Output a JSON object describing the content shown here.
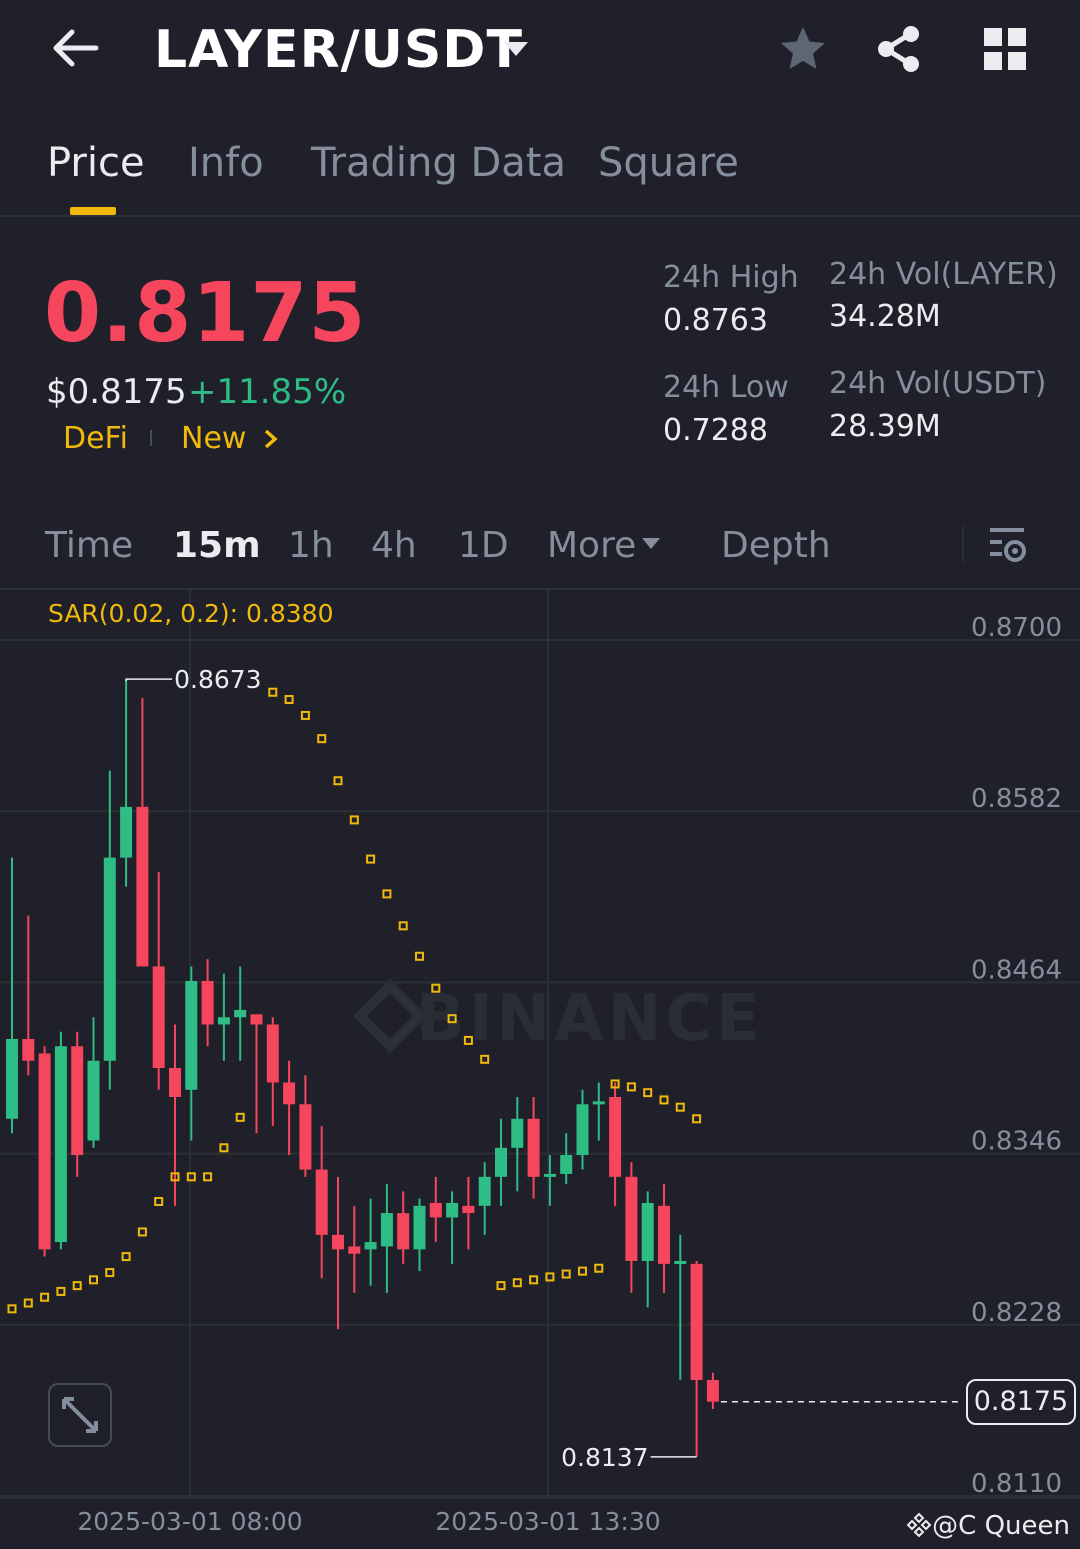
{
  "header": {
    "pair": "LAYER/USDT"
  },
  "tabs": [
    "Price",
    "Info",
    "Trading Data",
    "Square"
  ],
  "ticker": {
    "last_price": "0.8175",
    "usd_price": "$0.8175",
    "change_pct": "+11.85%",
    "tags": [
      "DeFi",
      "New"
    ],
    "high_label": "24h High",
    "high_value": "0.8763",
    "low_label": "24h Low",
    "low_value": "0.7288",
    "vol_base_label": "24h Vol(LAYER)",
    "vol_base_value": "34.28M",
    "vol_quote_label": "24h Vol(USDT)",
    "vol_quote_value": "28.39M"
  },
  "intervals": {
    "items": [
      "Time",
      "15m",
      "1h",
      "4h",
      "1D"
    ],
    "more": "More",
    "depth": "Depth",
    "active": "15m"
  },
  "indicator": {
    "label": "SAR(0.02, 0.2): 0.8380"
  },
  "watermark": "BINANCE",
  "credit": "@C Queen",
  "colors": {
    "up": "#2ebd85",
    "down": "#f6465d",
    "accent": "#f0b90b",
    "background": "#1f2029"
  },
  "chart_data": {
    "type": "candlestick",
    "interval": "15m",
    "y_ticks": [
      "0.8700",
      "0.8582",
      "0.8464",
      "0.8346",
      "0.8228",
      "0.8110"
    ],
    "x_ticks": [
      "2025-03-01 08:00",
      "2025-03-01 13:30"
    ],
    "high_marker": "0.8673",
    "low_marker": "0.8137",
    "current_price": "0.8175",
    "candles": [
      {
        "o": 0.837,
        "h": 0.855,
        "l": 0.836,
        "c": 0.8425
      },
      {
        "o": 0.8425,
        "h": 0.851,
        "l": 0.84,
        "c": 0.841
      },
      {
        "o": 0.8415,
        "h": 0.842,
        "l": 0.8275,
        "c": 0.828
      },
      {
        "o": 0.8285,
        "h": 0.843,
        "l": 0.828,
        "c": 0.842
      },
      {
        "o": 0.842,
        "h": 0.843,
        "l": 0.833,
        "c": 0.8345
      },
      {
        "o": 0.8355,
        "h": 0.844,
        "l": 0.835,
        "c": 0.841
      },
      {
        "o": 0.841,
        "h": 0.861,
        "l": 0.839,
        "c": 0.855
      },
      {
        "o": 0.855,
        "h": 0.8673,
        "l": 0.853,
        "c": 0.8585
      },
      {
        "o": 0.8585,
        "h": 0.866,
        "l": 0.848,
        "c": 0.8475
      },
      {
        "o": 0.8475,
        "h": 0.854,
        "l": 0.839,
        "c": 0.8405
      },
      {
        "o": 0.8405,
        "h": 0.8435,
        "l": 0.831,
        "c": 0.8385
      },
      {
        "o": 0.839,
        "h": 0.8475,
        "l": 0.8355,
        "c": 0.8465
      },
      {
        "o": 0.8465,
        "h": 0.848,
        "l": 0.842,
        "c": 0.8435
      },
      {
        "o": 0.8435,
        "h": 0.847,
        "l": 0.841,
        "c": 0.844
      },
      {
        "o": 0.844,
        "h": 0.8475,
        "l": 0.841,
        "c": 0.8445
      },
      {
        "o": 0.8442,
        "h": 0.844,
        "l": 0.836,
        "c": 0.8435
      },
      {
        "o": 0.8435,
        "h": 0.844,
        "l": 0.8365,
        "c": 0.8395
      },
      {
        "o": 0.8395,
        "h": 0.841,
        "l": 0.8345,
        "c": 0.838
      },
      {
        "o": 0.838,
        "h": 0.84,
        "l": 0.833,
        "c": 0.8335
      },
      {
        "o": 0.8335,
        "h": 0.8365,
        "l": 0.826,
        "c": 0.829
      },
      {
        "o": 0.829,
        "h": 0.833,
        "l": 0.8225,
        "c": 0.828
      },
      {
        "o": 0.8282,
        "h": 0.831,
        "l": 0.825,
        "c": 0.8277
      },
      {
        "o": 0.828,
        "h": 0.8315,
        "l": 0.8255,
        "c": 0.8285
      },
      {
        "o": 0.8282,
        "h": 0.8325,
        "l": 0.825,
        "c": 0.8305
      },
      {
        "o": 0.8305,
        "h": 0.832,
        "l": 0.827,
        "c": 0.828
      },
      {
        "o": 0.828,
        "h": 0.8315,
        "l": 0.8265,
        "c": 0.831
      },
      {
        "o": 0.8312,
        "h": 0.833,
        "l": 0.8285,
        "c": 0.8302
      },
      {
        "o": 0.8302,
        "h": 0.832,
        "l": 0.827,
        "c": 0.8312
      },
      {
        "o": 0.831,
        "h": 0.833,
        "l": 0.828,
        "c": 0.8305
      },
      {
        "o": 0.831,
        "h": 0.834,
        "l": 0.829,
        "c": 0.833
      },
      {
        "o": 0.833,
        "h": 0.837,
        "l": 0.831,
        "c": 0.835
      },
      {
        "o": 0.835,
        "h": 0.8385,
        "l": 0.832,
        "c": 0.837
      },
      {
        "o": 0.837,
        "h": 0.8385,
        "l": 0.8315,
        "c": 0.833
      },
      {
        "o": 0.833,
        "h": 0.8345,
        "l": 0.831,
        "c": 0.8332
      },
      {
        "o": 0.8332,
        "h": 0.836,
        "l": 0.8325,
        "c": 0.8345
      },
      {
        "o": 0.8345,
        "h": 0.839,
        "l": 0.8335,
        "c": 0.838
      },
      {
        "o": 0.838,
        "h": 0.8395,
        "l": 0.8355,
        "c": 0.8382
      },
      {
        "o": 0.8385,
        "h": 0.8395,
        "l": 0.831,
        "c": 0.833
      },
      {
        "o": 0.833,
        "h": 0.834,
        "l": 0.825,
        "c": 0.8272
      },
      {
        "o": 0.8272,
        "h": 0.832,
        "l": 0.824,
        "c": 0.8312
      },
      {
        "o": 0.831,
        "h": 0.8325,
        "l": 0.825,
        "c": 0.827
      },
      {
        "o": 0.827,
        "h": 0.829,
        "l": 0.819,
        "c": 0.8272
      },
      {
        "o": 0.827,
        "h": 0.8272,
        "l": 0.8137,
        "c": 0.819
      },
      {
        "o": 0.819,
        "h": 0.8195,
        "l": 0.817,
        "c": 0.8175
      }
    ],
    "sar": [
      {
        "i": 0,
        "v": 0.8239
      },
      {
        "i": 1,
        "v": 0.8243
      },
      {
        "i": 2,
        "v": 0.8247
      },
      {
        "i": 3,
        "v": 0.8251
      },
      {
        "i": 4,
        "v": 0.8255
      },
      {
        "i": 5,
        "v": 0.8259
      },
      {
        "i": 6,
        "v": 0.8264
      },
      {
        "i": 7,
        "v": 0.8275
      },
      {
        "i": 8,
        "v": 0.8292
      },
      {
        "i": 9,
        "v": 0.8313
      },
      {
        "i": 10,
        "v": 0.833
      },
      {
        "i": 11,
        "v": 0.833
      },
      {
        "i": 12,
        "v": 0.833
      },
      {
        "i": 13,
        "v": 0.835
      },
      {
        "i": 14,
        "v": 0.8371
      },
      {
        "i": 16,
        "v": 0.8664
      },
      {
        "i": 17,
        "v": 0.8659
      },
      {
        "i": 18,
        "v": 0.8648
      },
      {
        "i": 19,
        "v": 0.8632
      },
      {
        "i": 20,
        "v": 0.8603
      },
      {
        "i": 21,
        "v": 0.8576
      },
      {
        "i": 22,
        "v": 0.8549
      },
      {
        "i": 23,
        "v": 0.8525
      },
      {
        "i": 24,
        "v": 0.8503
      },
      {
        "i": 25,
        "v": 0.8482
      },
      {
        "i": 26,
        "v": 0.846
      },
      {
        "i": 27,
        "v": 0.8439
      },
      {
        "i": 28,
        "v": 0.8424
      },
      {
        "i": 29,
        "v": 0.8411
      },
      {
        "i": 30,
        "v": 0.8255
      },
      {
        "i": 31,
        "v": 0.8257
      },
      {
        "i": 32,
        "v": 0.8259
      },
      {
        "i": 33,
        "v": 0.8261
      },
      {
        "i": 34,
        "v": 0.8263
      },
      {
        "i": 35,
        "v": 0.8265
      },
      {
        "i": 36,
        "v": 0.8267
      },
      {
        "i": 37,
        "v": 0.8394
      },
      {
        "i": 38,
        "v": 0.8392
      },
      {
        "i": 39,
        "v": 0.8388
      },
      {
        "i": 40,
        "v": 0.8383
      },
      {
        "i": 41,
        "v": 0.8378
      },
      {
        "i": 42,
        "v": 0.837
      }
    ]
  }
}
